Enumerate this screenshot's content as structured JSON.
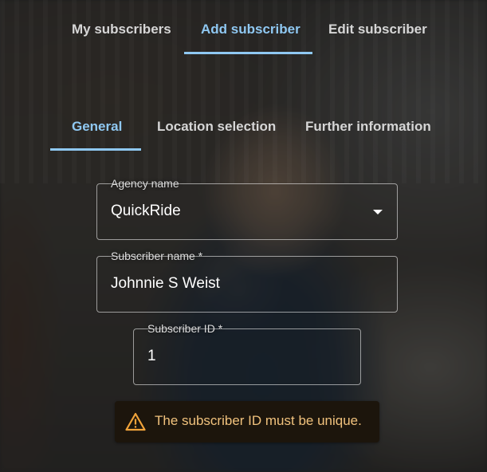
{
  "top_tabs": [
    {
      "label": "My subscribers",
      "active": false
    },
    {
      "label": "Add subscriber",
      "active": true
    },
    {
      "label": "Edit subscriber",
      "active": false
    }
  ],
  "sub_tabs": [
    {
      "label": "General",
      "active": true
    },
    {
      "label": "Location selection",
      "active": false
    },
    {
      "label": "Further information",
      "active": false
    }
  ],
  "form": {
    "agency": {
      "label": "Agency name",
      "value": "QuickRide"
    },
    "subscriber_name": {
      "label": "Subscriber name *",
      "value": "Johnnie S Weist"
    },
    "subscriber_id": {
      "label": "Subscriber ID *",
      "value": "1"
    }
  },
  "alert": {
    "message": "The subscriber ID must be unique.",
    "icon": "warning-icon",
    "color": "#f0a33a"
  },
  "colors": {
    "accent": "#8fc8f2"
  }
}
